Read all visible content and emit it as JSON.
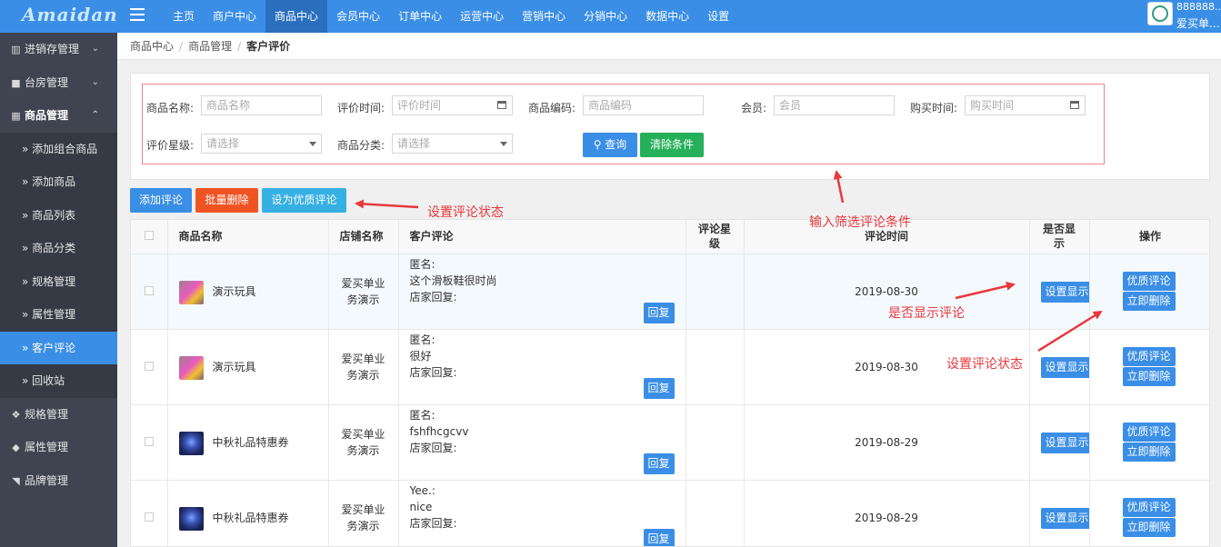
{
  "app": {
    "logo": "Amaidan"
  },
  "topnav": [
    "主页",
    "商户中心",
    "商品中心",
    "会员中心",
    "订单中心",
    "运营中心",
    "营销中心",
    "分销中心",
    "数据中心",
    "设置"
  ],
  "user": {
    "id": "888888...",
    "name": "爱买单..."
  },
  "sidebar": {
    "groups_top": [
      {
        "label": "进销存管理",
        "icon": "map-icon"
      },
      {
        "label": "台房管理",
        "icon": "bookmark-icon"
      },
      {
        "label": "商品管理",
        "icon": "grid-icon"
      }
    ],
    "sub_items": [
      "添加组合商品",
      "添加商品",
      "商品列表",
      "商品分类",
      "规格管理",
      "属性管理",
      "客户评论",
      "回收站"
    ],
    "active_sub": "客户评论",
    "groups_bottom": [
      {
        "label": "规格管理",
        "icon": "cubes-icon"
      },
      {
        "label": "属性管理",
        "icon": "cube-icon"
      },
      {
        "label": "品牌管理",
        "icon": "tag-icon"
      }
    ]
  },
  "breadcrumb": [
    "商品中心",
    "商品管理",
    "客户评价"
  ],
  "filters": {
    "product_name": {
      "label": "商品名称:",
      "placeholder": "商品名称"
    },
    "review_time": {
      "label": "评价时间:",
      "placeholder": "评价时间"
    },
    "product_code": {
      "label": "商品编码:",
      "placeholder": "商品编码"
    },
    "member": {
      "label": "会员:",
      "placeholder": "会员"
    },
    "purchase_time": {
      "label": "购买时间:",
      "placeholder": "购买时间"
    },
    "rating": {
      "label": "评价星级:",
      "value": "请选择"
    },
    "category": {
      "label": "商品分类:",
      "value": "请选择"
    },
    "search_button": "查询",
    "clear_button": "清除条件"
  },
  "actions": {
    "add": "添加评论",
    "batch_delete": "批量删除",
    "set_quality": "设为优质评论"
  },
  "table": {
    "headers": {
      "name": "商品名称",
      "shop": "店铺名称",
      "comment": "客户评论",
      "rating_line1": "评论星",
      "rating_line2": "级",
      "time": "评论时间",
      "show_line1": "是否显",
      "show_line2": "示",
      "ops": "操作"
    },
    "reply_label": "回复",
    "show_label": "设置显示",
    "quality_label": "优质评论",
    "delete_label": "立即删除",
    "rows": [
      {
        "product": "演示玩具",
        "thumb": "toy",
        "shop_line1": "爱买单业",
        "shop_line2": "务演示",
        "author": "匿名:",
        "text": "这个滑板鞋很时尚",
        "reply": "店家回复:",
        "time": "2019-08-30"
      },
      {
        "product": "演示玩具",
        "thumb": "toy",
        "shop_line1": "爱买单业",
        "shop_line2": "务演示",
        "author": "匿名:",
        "text": "很好",
        "reply": "店家回复:",
        "time": "2019-08-30"
      },
      {
        "product": "中秋礼品特惠券",
        "thumb": "coupon",
        "shop_line1": "爱买单业",
        "shop_line2": "务演示",
        "author": "匿名:",
        "text": "fshfhcgcvv",
        "reply": "店家回复:",
        "time": "2019-08-29"
      },
      {
        "product": "中秋礼品特惠券",
        "thumb": "coupon",
        "shop_line1": "爱买单业",
        "shop_line2": "务演示",
        "author": "Yee.:",
        "text": "nice",
        "reply": "店家回复:",
        "time": "2019-08-29"
      }
    ]
  },
  "annotations": {
    "set_status_top": "设置评论状态",
    "filter_conditions": "输入筛选评论条件",
    "show_toggle": "是否显示评论",
    "set_status_right": "设置评论状态"
  },
  "colors": {
    "primary": "#3a8ee6",
    "sidebar": "#3f4450",
    "annotation": "#e8383d",
    "danger": "#f05424",
    "success": "#26b05a",
    "info": "#36b0e2"
  }
}
